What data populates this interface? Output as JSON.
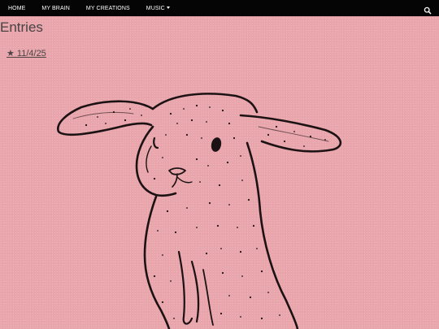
{
  "nav": {
    "items": [
      {
        "label": "HOME"
      },
      {
        "label": "MY BRAIN"
      },
      {
        "label": "MY CREATIONS"
      },
      {
        "label": "MUSIC"
      }
    ],
    "search_icon": "search-icon",
    "dropdown_icon": "caret-down-icon"
  },
  "page": {
    "heading": "Entries",
    "entries": [
      {
        "label": "★ 11/4/25"
      }
    ]
  },
  "illustration": {
    "subject": "rabbit-drawing"
  },
  "colors": {
    "background": "#e9a6ac",
    "navbar": "#050505",
    "nav_text": "#ffffff",
    "heading_text": "#474244",
    "link_text": "#4b4547",
    "ink": "#1c1214"
  }
}
